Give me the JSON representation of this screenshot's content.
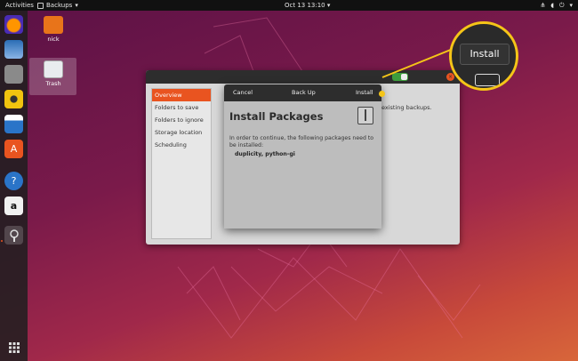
{
  "topbar": {
    "activities": "Activities",
    "app_name": "Backups",
    "app_menu_arrow": "▾",
    "clock": "Oct 13  13:10",
    "clock_arrow": "▾",
    "tray": {
      "network": "⋔",
      "volume": "◖",
      "power": "⏻",
      "arrow": "▾"
    }
  },
  "desktop": {
    "icons": [
      {
        "label": "nick",
        "icon": "home-folder-icon"
      },
      {
        "label": "Trash",
        "icon": "trash-icon"
      }
    ]
  },
  "dock": {
    "items": [
      {
        "name": "firefox-icon",
        "glyph": ""
      },
      {
        "name": "thunderbird-icon",
        "glyph": ""
      },
      {
        "name": "files-icon",
        "glyph": ""
      },
      {
        "name": "rhythmbox-icon",
        "glyph": ""
      },
      {
        "name": "libreoffice-writer-icon",
        "glyph": ""
      },
      {
        "name": "software-center-icon",
        "glyph": "A"
      },
      {
        "name": "help-icon",
        "glyph": "?"
      },
      {
        "name": "amazon-icon",
        "glyph": "a"
      },
      {
        "name": "backups-icon",
        "glyph": ""
      },
      {
        "name": "show-applications-icon",
        "glyph": ""
      }
    ]
  },
  "backups": {
    "sidebar": [
      {
        "label": "Overview",
        "selected": true
      },
      {
        "label": "Folders to save"
      },
      {
        "label": "Folders to ignore"
      },
      {
        "label": "Storage location"
      },
      {
        "label": "Scheduling"
      }
    ],
    "content_text": "existing backups.",
    "close_glyph": "×"
  },
  "dialog": {
    "cancel_label": "Cancel",
    "title_bar": "Back Up",
    "install_label": "Install",
    "heading": "Install Packages",
    "message": "In order to continue, the following packages need to be installed:",
    "packages": "duplicity, python-gi"
  },
  "callout": {
    "label": "Install"
  },
  "colors": {
    "accent": "#e95420",
    "highlight": "#f5c518",
    "toggle_on": "#3d9d3d"
  }
}
